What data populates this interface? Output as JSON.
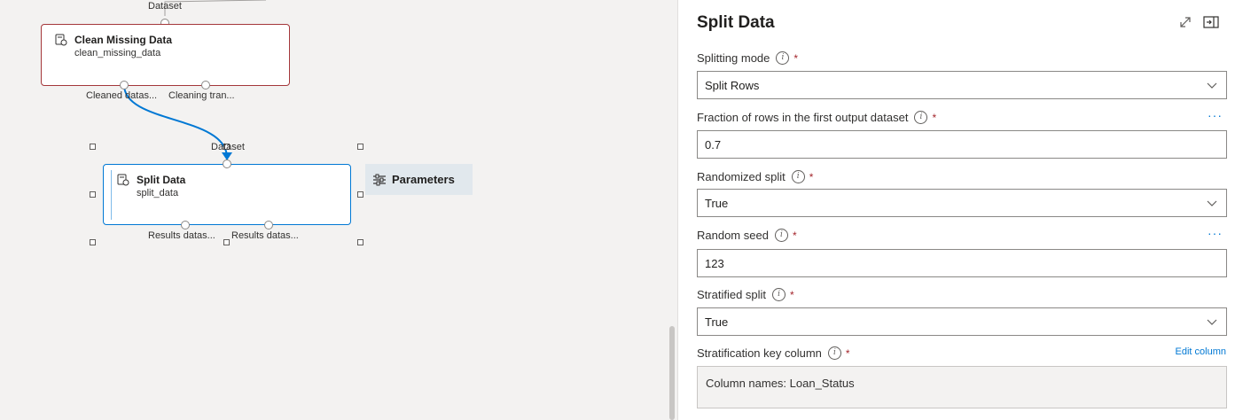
{
  "canvas": {
    "top_port_label": "Dataset",
    "clean_module": {
      "title": "Clean Missing Data",
      "subtitle": "clean_missing_data",
      "out_port_1": "Cleaned datas...",
      "out_port_2": "Cleaning tran..."
    },
    "split_module": {
      "in_port_label": "Dataset",
      "title": "Split Data",
      "subtitle": "split_data",
      "out_port_1": "Results datas...",
      "out_port_2": "Results datas..."
    },
    "parameters_tab": "Parameters"
  },
  "panel": {
    "title": "Split Data",
    "fields": {
      "splitting_mode": {
        "label": "Splitting mode",
        "value": "Split Rows"
      },
      "fraction": {
        "label": "Fraction of rows in the first output dataset",
        "value": "0.7"
      },
      "randomized": {
        "label": "Randomized split",
        "value": "True"
      },
      "seed": {
        "label": "Random seed",
        "value": "123"
      },
      "stratified": {
        "label": "Stratified split",
        "value": "True"
      },
      "strat_key": {
        "label": "Stratification key column",
        "value": "Column names: Loan_Status",
        "edit_link": "Edit column"
      }
    },
    "required_mark": "*",
    "more_glyph": "···"
  },
  "colors": {
    "accent": "#0078d4",
    "clean_module_border": "#a4373a",
    "selected_module_border": "#0078d4",
    "parameters_tab_bg": "#e1e8ed"
  }
}
